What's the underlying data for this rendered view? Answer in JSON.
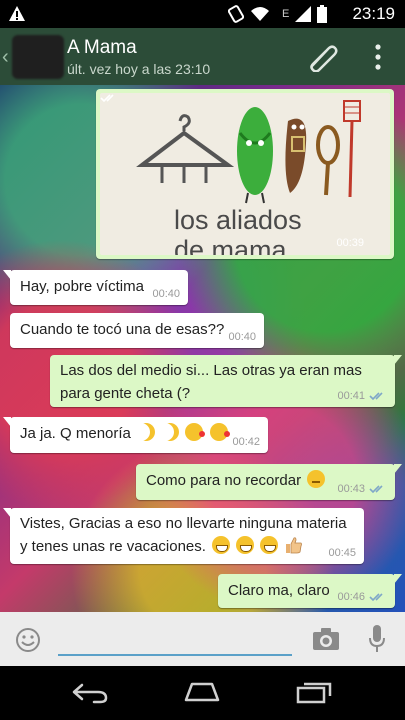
{
  "status_bar": {
    "time": "23:19",
    "network_letter": "E"
  },
  "header": {
    "contact_name": "A Mama",
    "last_seen": "últ. vez hoy a las 23:10"
  },
  "image_message": {
    "caption_line1": "los aliados",
    "caption_line2": "de mama",
    "time": "00:39"
  },
  "messages": [
    {
      "direction": "in",
      "text": "Hay, pobre víctima",
      "time": "00:40"
    },
    {
      "direction": "in",
      "text": "Cuando te tocó una de esas??",
      "time": "00:40"
    },
    {
      "direction": "out",
      "text_line1": "Las dos del medio si... Las otras ya eran mas",
      "text_line2": "para gente cheta (?",
      "time": "00:41"
    },
    {
      "direction": "in",
      "text": "Ja ja. Q menoría",
      "time": "00:42",
      "emojis": [
        "moon-icon",
        "moon-icon",
        "kiss-emoji-icon",
        "kiss-emoji-icon"
      ]
    },
    {
      "direction": "out",
      "text": "Como para no recordar",
      "time": "00:43",
      "emojis": [
        "unamused-emoji-icon"
      ]
    },
    {
      "direction": "in",
      "text_line1": "Vistes, Gracias a eso no llevarte ninguna materia",
      "text_line2": "y tenes unas re vacaciones.",
      "time": "00:45",
      "emojis": [
        "grin-emoji-icon",
        "grin-emoji-icon",
        "grin-emoji-icon",
        "thumbs-up-icon"
      ]
    },
    {
      "direction": "out",
      "text": "Claro ma, claro",
      "time": "00:46"
    }
  ],
  "colors": {
    "header_bg": "#2c4c38",
    "bubble_out": "#dcf8c6",
    "bubble_in": "#ffffff",
    "read_check": "#7fa7c8",
    "input_underline": "#5aa0c8"
  }
}
